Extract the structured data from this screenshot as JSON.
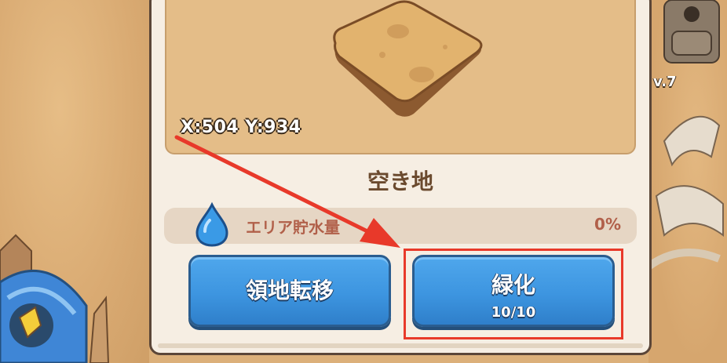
{
  "map": {
    "coordinates": "X:504 Y:934",
    "level_partial": "v.7"
  },
  "tile_panel": {
    "title": "空き地",
    "water_label": "エリア貯水量",
    "water_value": "0%",
    "buttons": {
      "transfer_label": "領地転移",
      "greening_label": "緑化",
      "greening_count": "10/10"
    }
  },
  "annotation": {
    "arrow_color": "#e8392a",
    "highlight_color": "#e8392a"
  },
  "colors": {
    "button_blue": "#3d95e0",
    "panel_bg": "#f6eee3",
    "sand": "#dcb07a",
    "title_brown": "#6b4a2e"
  },
  "icons": [
    "water-drop-icon",
    "sand-tile-icon",
    "building-icon",
    "bone-icon",
    "golem-icon"
  ]
}
